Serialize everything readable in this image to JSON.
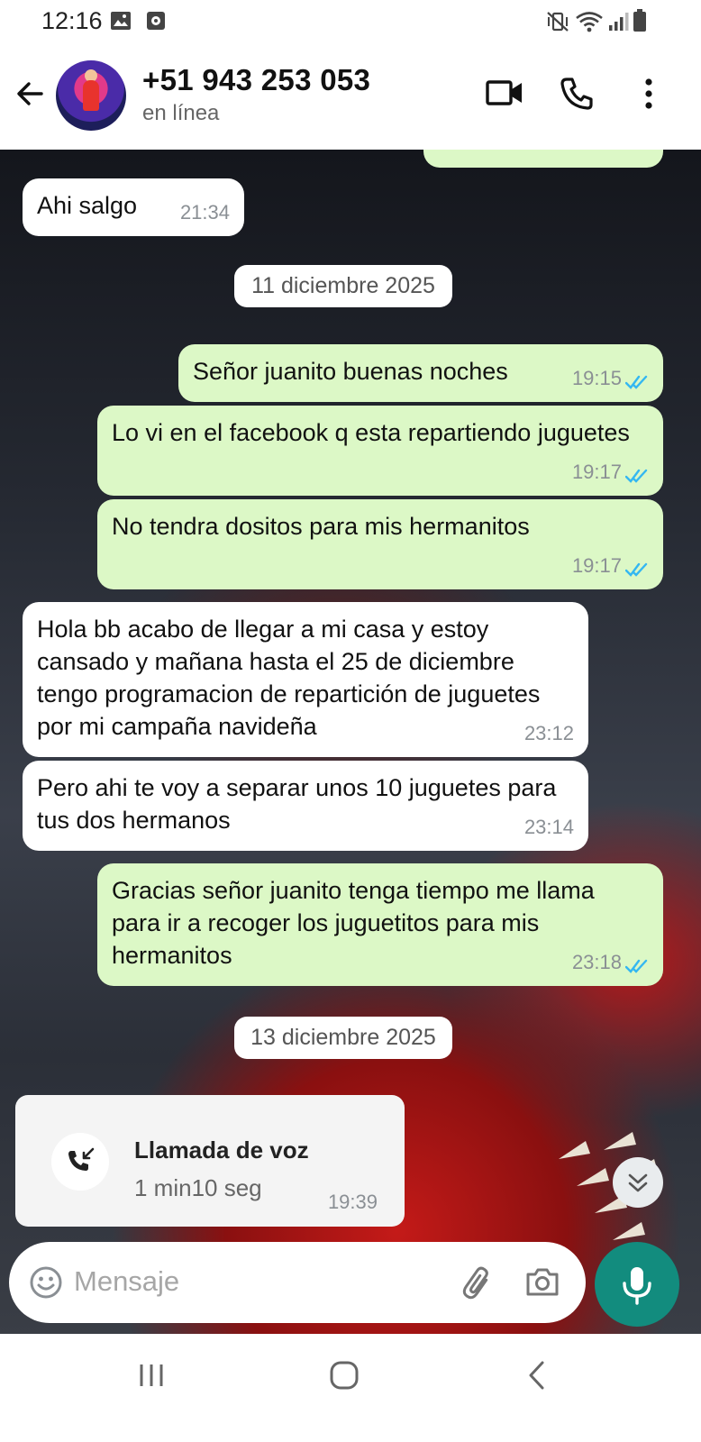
{
  "status_bar": {
    "time": "12:16",
    "left_icons": [
      "image-icon",
      "notification-icon"
    ],
    "right_icons": [
      "vibrate-mute-icon",
      "wifi-icon",
      "signal-icon",
      "battery-icon"
    ]
  },
  "header": {
    "contact_name": "+51 943 253 053",
    "status": "en línea",
    "actions": [
      "video-call-icon",
      "voice-call-icon",
      "more-options-icon"
    ]
  },
  "messages": [
    {
      "direction": "in",
      "text": "Ahi salgo",
      "time": "21:34"
    },
    {
      "type": "date",
      "text": "11 diciembre 2025"
    },
    {
      "direction": "out",
      "text": "Señor juanito buenas noches",
      "time": "19:15",
      "read": true
    },
    {
      "direction": "out",
      "text": "Lo vi en el facebook q esta repartiendo juguetes",
      "time": "19:17",
      "read": true
    },
    {
      "direction": "out",
      "text": "No tendra dositos para mis hermanitos",
      "time": "19:17",
      "read": true
    },
    {
      "direction": "in",
      "text": "Hola bb acabo de llegar a mi casa y estoy cansado y mañana hasta el 25 de diciembre tengo programacion de repartición de juguetes por mi campaña navideña",
      "time": "23:12"
    },
    {
      "direction": "in",
      "text": "Pero ahi te voy a separar unos 10 juguetes para tus dos hermanos",
      "time": "23:14"
    },
    {
      "direction": "out",
      "text": "Gracias señor juanito tenga tiempo me llama para ir a recoger los juguetitos para mis hermanitos",
      "time": "23:18",
      "read": true
    },
    {
      "type": "date",
      "text": "13 diciembre 2025"
    },
    {
      "type": "call",
      "title": "Llamada de voz",
      "duration": "1 min10 seg",
      "time": "19:39"
    }
  ],
  "composer": {
    "placeholder": "Mensaje",
    "icons": [
      "emoji-icon",
      "attach-icon",
      "camera-icon",
      "mic-icon"
    ]
  },
  "nav_bar": [
    "recent-apps-icon",
    "home-icon",
    "back-nav-icon"
  ],
  "colors": {
    "outgoing_bubble": "#dcf8c6",
    "incoming_bubble": "#ffffff",
    "read_ticks": "#34b7f1",
    "mic_button": "#128c7e"
  }
}
